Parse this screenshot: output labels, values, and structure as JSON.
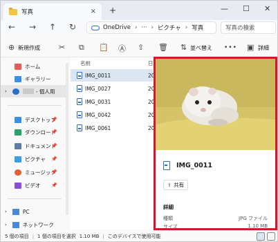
{
  "window": {
    "tab_title": "写真",
    "close_glyph": "×",
    "new_tab_glyph": "+",
    "minimize_glyph": "—",
    "maximize_glyph": "☐",
    "window_close_glyph": "✕"
  },
  "address": {
    "back_glyph": "←",
    "forward_glyph": "→",
    "up_glyph": "↑",
    "refresh_glyph": "↻",
    "crumb_root": "OneDrive",
    "crumb_more": "···",
    "crumb_1": "ピクチャ",
    "crumb_2": "写真",
    "separator": "›",
    "search_placeholder": "写真の検索"
  },
  "toolbar": {
    "new_label": "新規作成",
    "sort_label": "並べ替え",
    "more_label": "•••",
    "details_label": "詳細"
  },
  "sidebar": {
    "items": [
      {
        "label": "ホーム",
        "color": "#e45b5b"
      },
      {
        "label": "ギャラリー",
        "color": "#3a8ee6"
      },
      {
        "label": "- 個人用",
        "color": "#2a6fc9"
      },
      {
        "label": "デスクトップ",
        "color": "#3a8ee6"
      },
      {
        "label": "ダウンロード",
        "color": "#2aa36b"
      },
      {
        "label": "ドキュメント",
        "color": "#5f7aa3"
      },
      {
        "label": "ピクチャ",
        "color": "#3aa0e6"
      },
      {
        "label": "ミュージック",
        "color": "#e2603a"
      },
      {
        "label": "ビデオ",
        "color": "#8a4fd3"
      },
      {
        "label": "PC",
        "color": "#4a88d8"
      },
      {
        "label": "ネットワーク",
        "color": "#4a88d8"
      }
    ]
  },
  "files": {
    "col_name": "名前",
    "col_date": "日",
    "rows": [
      {
        "name": "IMG_0011",
        "date": "20"
      },
      {
        "name": "IMG_0027",
        "date": "20"
      },
      {
        "name": "IMG_0031",
        "date": "20"
      },
      {
        "name": "IMG_0042",
        "date": "20"
      },
      {
        "name": "IMG_0061",
        "date": "20"
      }
    ]
  },
  "details": {
    "title": "IMG_0011",
    "share_label": "共有",
    "section": "詳細",
    "type_label": "種類",
    "type_value": "JPG ファイル",
    "size_label": "サイズ",
    "size_value": "1.10 MB"
  },
  "status": {
    "count": "5 個の項目",
    "selected": "1 個の項目を選択",
    "size": "1.10 MB",
    "device": "このデバイスで使用可能"
  },
  "colors": {
    "highlight_border": "#d3182b",
    "selection": "#dbe6f2"
  }
}
